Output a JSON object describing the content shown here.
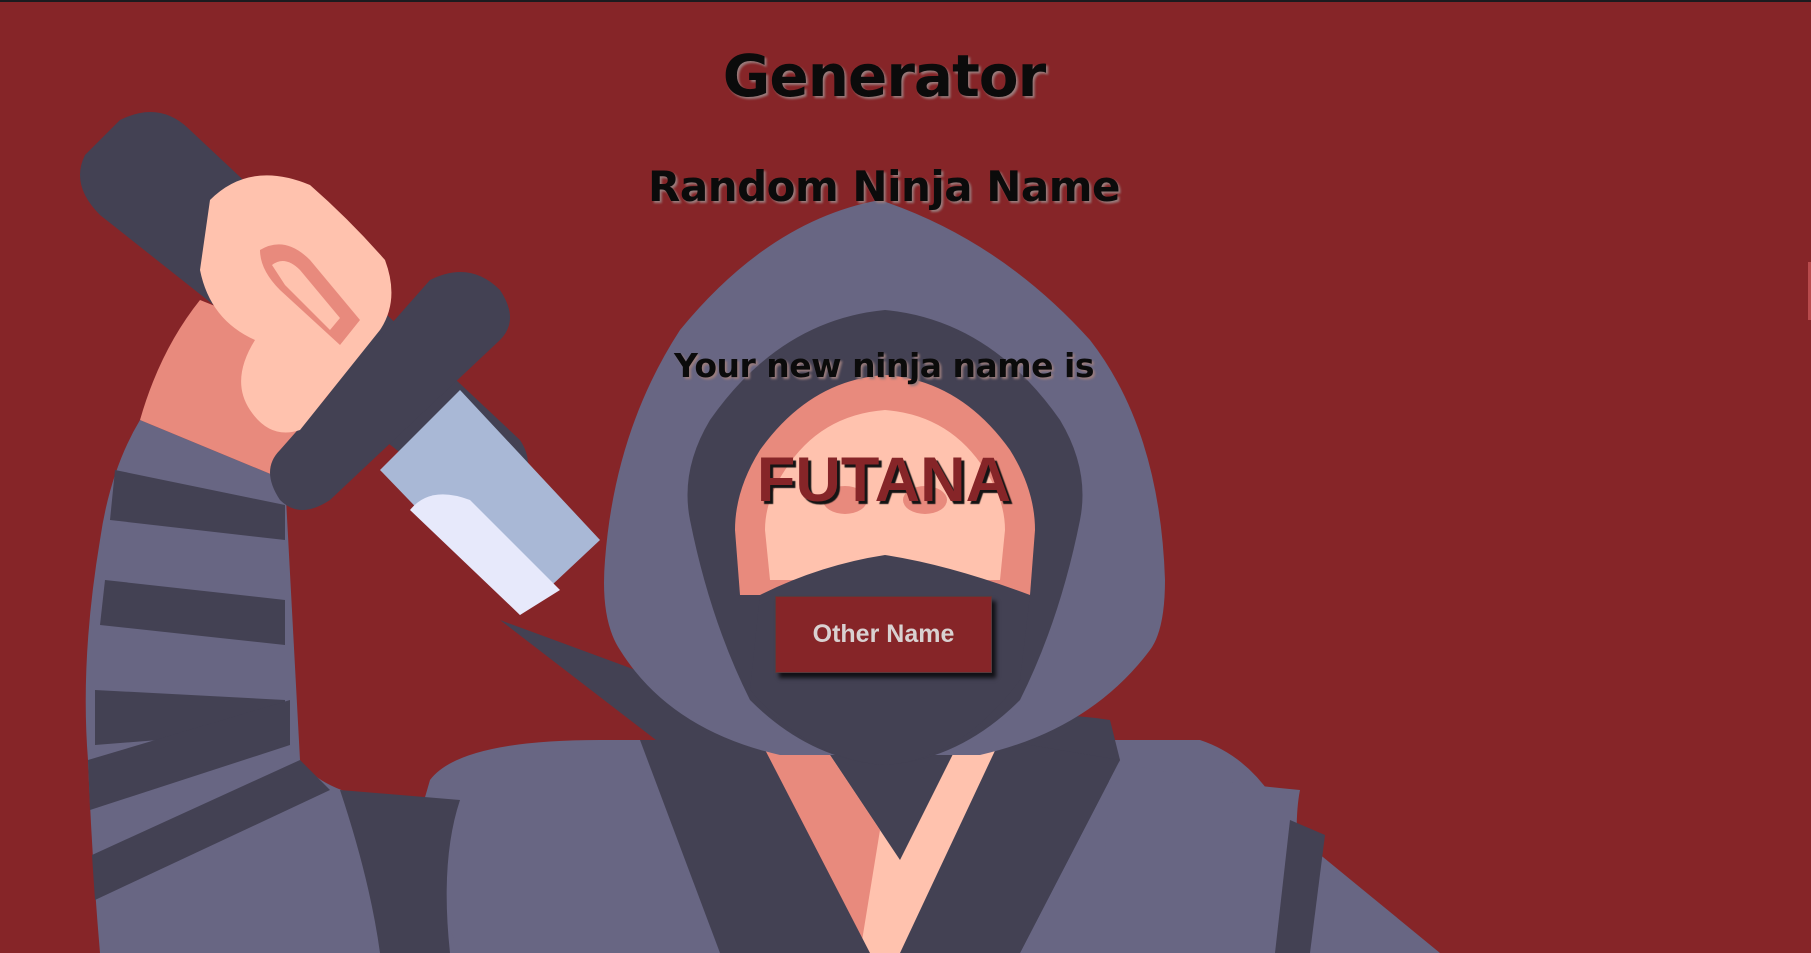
{
  "page": {
    "background_color": "#862528",
    "title": "Generator",
    "subtitle": "Random Ninja Name"
  },
  "result": {
    "lead_text": "Your new ninja name is",
    "ninja_name": "FUTANA"
  },
  "actions": {
    "other_name_label": "Other Name"
  },
  "illustration": {
    "name": "ninja-with-sword",
    "colors": {
      "dark": "#434153",
      "hood": "#686683",
      "skin": "#ffc2ae",
      "skin_shadow": "#e88a7d",
      "blade": "#a9b8d6",
      "blade_light": "#e7e9fb"
    }
  }
}
